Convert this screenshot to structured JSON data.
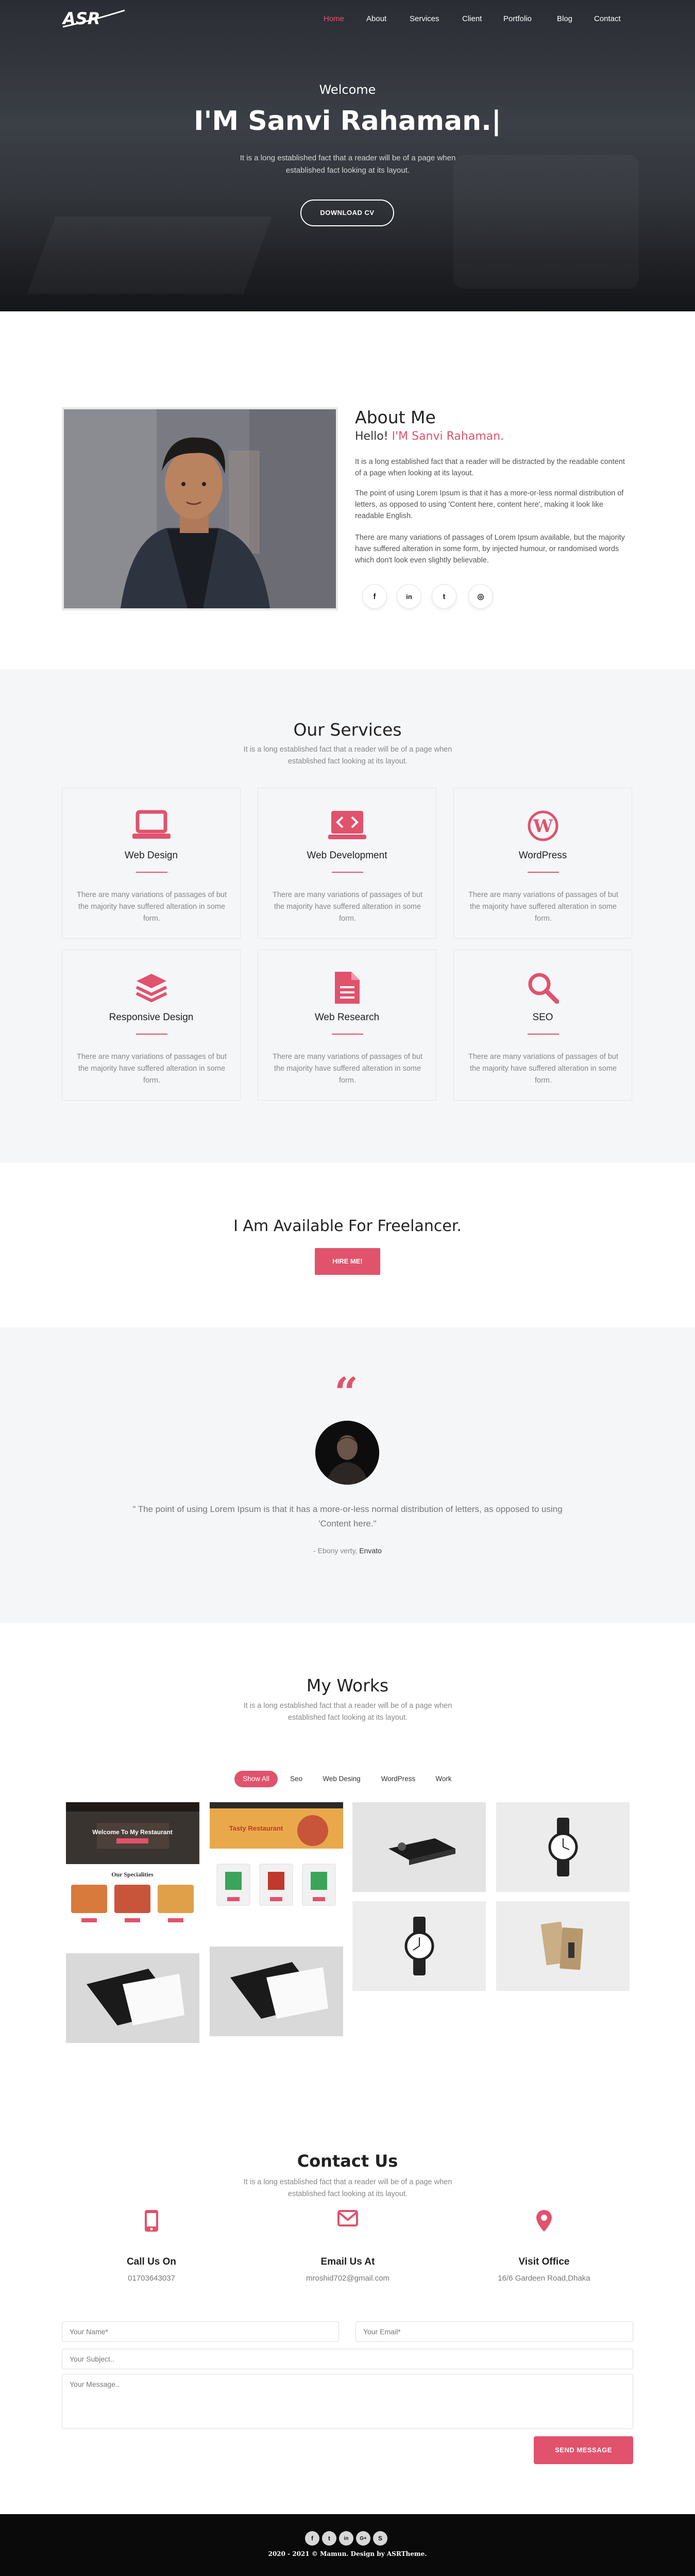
{
  "brand": {
    "logo_text": "ASR",
    "accent_color": "#e1526d"
  },
  "nav": {
    "items": [
      {
        "label": "Home",
        "active": true
      },
      {
        "label": "About"
      },
      {
        "label": "Services"
      },
      {
        "label": "Client"
      },
      {
        "label": "Portfolio"
      },
      {
        "label": "Blog"
      },
      {
        "label": "Contact"
      }
    ]
  },
  "hero": {
    "welcome": "Welcome",
    "name": "I'M Sanvi Rahaman.|",
    "description": "It is a long established fact that a reader will be of a page when established fact looking at its layout.",
    "cv_button": "DOWNLOAD CV"
  },
  "about": {
    "title": "About Me",
    "hello": "Hello!",
    "hello_name": "I'M Sanvi Rahaman.",
    "p1": "It is a long established fact that a reader will be distracted by the readable content of a page when looking at its layout.",
    "p2": "The point of using Lorem Ipsum is that it has a more-or-less normal distribution of letters, as opposed to using 'Content here, content here', making it look like readable English.",
    "p3": "There are many variations of passages of Lorem Ipsum available, but the majority have suffered alteration in some form, by injected humour, or randomised words which don't look even slightly believable.",
    "social": [
      {
        "icon": "facebook-icon",
        "glyph": "f"
      },
      {
        "icon": "linkedin-icon",
        "glyph": "in"
      },
      {
        "icon": "twitter-icon",
        "glyph": "t"
      },
      {
        "icon": "instagram-icon",
        "glyph": "◎"
      }
    ]
  },
  "services": {
    "title": "Our Services",
    "subtitle": "It is a long established fact that a reader will be of a page when established fact looking at its layout.",
    "items": [
      {
        "name": "Web Design",
        "icon": "laptop-icon",
        "desc": "There are many variations of passages of but the majority have suffered alteration in some form."
      },
      {
        "name": "Web Development",
        "icon": "code-icon",
        "desc": "There are many variations of passages of but the majority have suffered alteration in some form."
      },
      {
        "name": "WordPress",
        "icon": "wordpress-icon",
        "desc": "There are many variations of passages of but the majority have suffered alteration in some form."
      },
      {
        "name": "Responsive Design",
        "icon": "layers-icon",
        "desc": "There are many variations of passages of but the majority have suffered alteration in some form."
      },
      {
        "name": "Web Research",
        "icon": "document-icon",
        "desc": "There are many variations of passages of but the majority have suffered alteration in some form."
      },
      {
        "name": "SEO",
        "icon": "magnifier-icon",
        "desc": "There are many variations of passages of but the majority have suffered alteration in some form."
      }
    ]
  },
  "freelancer": {
    "title": "I Am Available For Freelancer.",
    "button": "HIRE ME!"
  },
  "testimonial": {
    "text": "\" The point of using Lorem Ipsum is that it has a more-or-less normal distribution of letters, as opposed to using 'Content here.\"",
    "author": "- Ebony verty,",
    "company": "Envato"
  },
  "works": {
    "title": "My Works",
    "subtitle": "It is a long established fact that a reader will be of a page when established fact looking at its layout.",
    "filters": [
      {
        "label": "Show All",
        "active": true
      },
      {
        "label": "Seo"
      },
      {
        "label": "Web Desing"
      },
      {
        "label": "WordPress"
      },
      {
        "label": "Work"
      }
    ],
    "thumb1": {
      "banner": "Welcome To My Restaurant",
      "heading": "Our Specialities"
    },
    "thumb2": {
      "banner": "Tasty Restaurant"
    }
  },
  "contact": {
    "title": "Contact Us",
    "subtitle": "It is a long established fact that a reader will be of a page when established fact looking at its layout.",
    "info": [
      {
        "title": "Call Us On",
        "value": "01703643037",
        "icon": "phone-icon"
      },
      {
        "title": "Email Us At",
        "value": "mroshid702@gmail.com",
        "icon": "envelope-icon"
      },
      {
        "title": "Visit Office",
        "value": "16/6 Gardeen Road,Dhaka",
        "icon": "map-pin-icon"
      }
    ],
    "form": {
      "name_placeholder": "Your Name*",
      "email_placeholder": "Your Email*",
      "subject_placeholder": "Your Subject..",
      "message_placeholder": "Your Message..",
      "send_button": "SEND MESSAGE"
    }
  },
  "footer": {
    "social": [
      {
        "icon": "facebook-icon",
        "glyph": "f"
      },
      {
        "icon": "twitter-icon",
        "glyph": "t"
      },
      {
        "icon": "linkedin-icon",
        "glyph": "in"
      },
      {
        "icon": "google-plus-icon",
        "glyph": "G+"
      },
      {
        "icon": "skype-icon",
        "glyph": "S"
      }
    ],
    "copyright": "2020 - 2021 © Mamun. Design by ASRTheme."
  }
}
